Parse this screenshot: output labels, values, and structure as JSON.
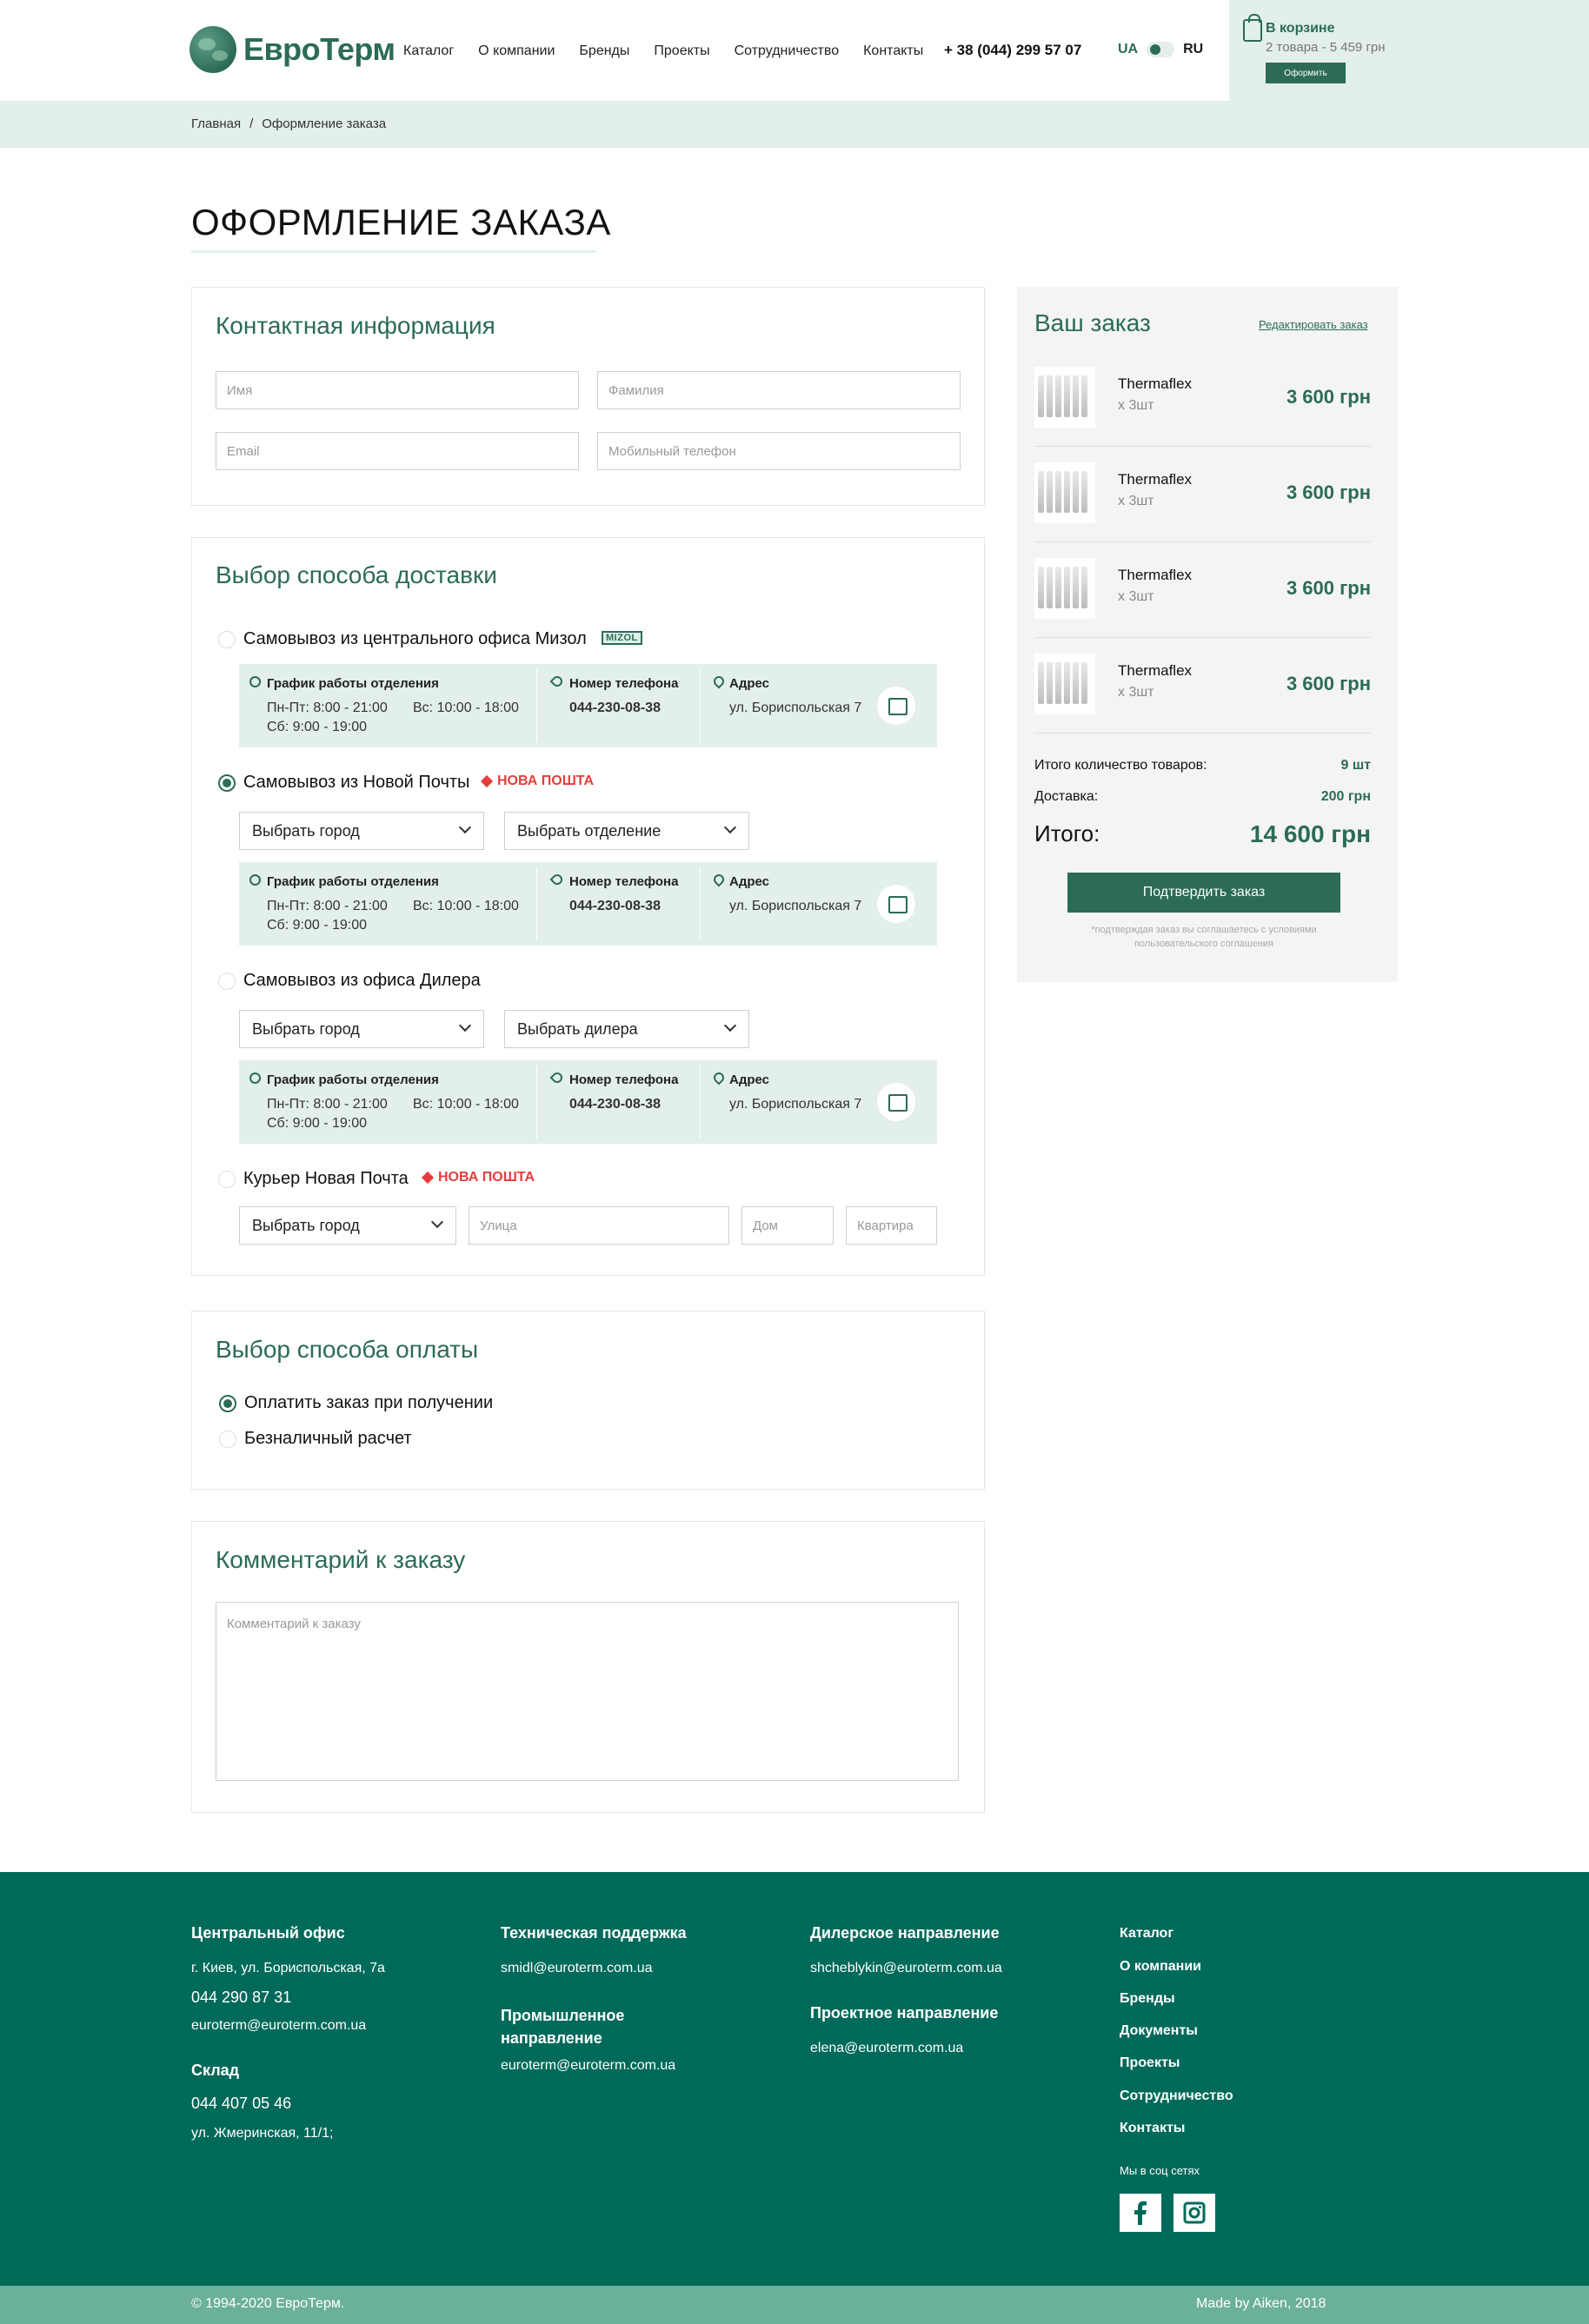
{
  "header": {
    "logo_text": "ЕвроТерм",
    "nav": [
      "Каталог",
      "О компании",
      "Бренды",
      "Проекты",
      "Сотрудничество",
      "Контакты"
    ],
    "phone": "+ 38 (044) 299 57 07",
    "lang_ua": "UA",
    "lang_ru": "RU",
    "cart": {
      "title": "В корзине",
      "subtitle": "2 товара - 5 459 грн",
      "button": "Оформить"
    }
  },
  "breadcrumb": {
    "home": "Главная",
    "separator": "/",
    "current": "Оформление заказа"
  },
  "page_title": "ОФОРМЛЕНИЕ ЗАКАЗА",
  "contact": {
    "title": "Контактная информация",
    "first_name": "Имя",
    "last_name": "Фамилия",
    "email": "Email",
    "phone": "Мобильный телефон"
  },
  "delivery": {
    "title": "Выбор способа доставки",
    "options": [
      {
        "label": "Самовывоз из центрального офиса Мизол",
        "badge": "MIZOL",
        "checked": false
      },
      {
        "label": "Самовывоз из Новой Почты",
        "badge": "НОВА ПОШТА",
        "checked": true,
        "select_city": "Выбрать город",
        "select_second": "Выбрать отделение"
      },
      {
        "label": "Самовывоз из офиса Дилера",
        "checked": false,
        "select_city": "Выбрать город",
        "select_second": "Выбрать дилера"
      },
      {
        "label": "Курьер Новая Почта",
        "badge": "НОВА ПОШТА",
        "checked": false,
        "select_city": "Выбрать город",
        "street": "Улица",
        "house": "Дом",
        "apartment": "Квартира"
      }
    ],
    "info": {
      "schedule_title": "График работы отделения",
      "weekdays": "Пн-Пт: 8:00 - 21:00",
      "sunday": "Вс: 10:00 - 18:00",
      "saturday": "Сб: 9:00 - 19:00",
      "phone_title": "Номер телефона",
      "phone": "044-230-08-38",
      "address_title": "Адрес",
      "address": "ул. Бориспольская 7"
    }
  },
  "payment": {
    "title": "Выбор способа оплаты",
    "options": [
      {
        "label": "Оплатить заказ при получении",
        "checked": true
      },
      {
        "label": "Безналичный расчет",
        "checked": false
      }
    ]
  },
  "comment": {
    "title": "Комментарий к заказу",
    "placeholder": "Комментарий к заказу"
  },
  "order": {
    "title": "Ваш заказ",
    "edit": "Редактировать заказ",
    "items": [
      {
        "name": "Thermaflex",
        "qty": "х 3шт",
        "price": "3 600 грн"
      },
      {
        "name": "Thermaflex",
        "qty": "х 3шт",
        "price": "3 600 грн"
      },
      {
        "name": "Thermaflex",
        "qty": "х 3шт",
        "price": "3 600 грн"
      },
      {
        "name": "Thermaflex",
        "qty": "х 3шт",
        "price": "3 600 грн"
      }
    ],
    "total_qty_label": "Итого количество товаров:",
    "total_qty": "9 шт",
    "delivery_label": "Доставка:",
    "delivery_value": "200 грн",
    "total_label": "Итого:",
    "total_value": "14 600 грн",
    "confirm": "Подтвердить заказ",
    "note": "*подтверждая заказ вы соглашаетесь с условиями пользовательского соглашения"
  },
  "footer": {
    "office_title": "Центральный офис",
    "office_address": "г. Киев, ул. Бориспольская, 7а",
    "office_phone": "044 290 87 31",
    "office_email": "euroterm@euroterm.com.ua",
    "warehouse_title": "Склад",
    "warehouse_phone": "044 407 05 46",
    "warehouse_address": "ул. Жмеринская, 11/1;",
    "support_title": "Техническая поддержка",
    "support_email": "smidl@euroterm.com.ua",
    "industrial_title": "Промышленное направление",
    "industrial_email": "euroterm@euroterm.com.ua",
    "dealer_title": "Дилерское направление",
    "dealer_email": "shcheblykin@euroterm.com.ua",
    "project_title": "Проектное направление",
    "project_email": "elena@euroterm.com.ua",
    "links": [
      "Каталог",
      "О компании",
      "Бренды",
      "Документы",
      "Проекты",
      "Сотрудничество",
      "Контакты"
    ],
    "social_title": "Мы в соц сетях",
    "copyright": "© 1994-2020 ЕвроТерм.",
    "made_by": "Made by Aiken, 2018"
  },
  "colors": {
    "brand": "#2c6b58",
    "footer": "#006a5a",
    "light": "#e2efec",
    "nova_poshta": "#e73c3e"
  }
}
